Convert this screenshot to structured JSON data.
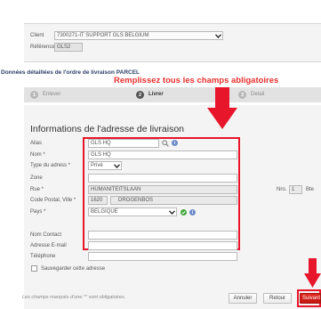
{
  "colors": {
    "accent_red": "#e8162b",
    "title_red": "#e8312f",
    "panel_bg": "#f4f4f4",
    "tab_bar_bg": "#e2e2e2",
    "step_active_bg": "#555555",
    "step_inactive_bg": "#b8b8b8",
    "ok_green": "#3fa93a",
    "info_blue": "#6c8cc8"
  },
  "top_panel": {
    "client_label": "Client",
    "client_value": "7300271-IT SUPPORT GLS BELGIUM",
    "reference_label": "Référence",
    "reference_value": "GLS2"
  },
  "section_title": "Données détaillées de l'ordre de livraison PARCEL",
  "annotation_text": "Remplissez tous les champs abligatoires",
  "steps": [
    {
      "number": "1",
      "label": "Enlever"
    },
    {
      "number": "2",
      "label": "Livrer"
    },
    {
      "number": "3",
      "label": "Detail"
    }
  ],
  "form": {
    "title": "Informations de l'adresse de livraison",
    "alias_label": "Alias",
    "alias_value": "GLS HQ",
    "nom_label": "Nom *",
    "nom_value": "GLS HQ",
    "type_label": "Type du adress *",
    "type_value": "Privé",
    "zone_label": "Zone",
    "zone_value": "",
    "rue_label": "Rue *",
    "rue_value": "HUMANITEITSLAAN",
    "nro_label": "Nro.",
    "nro_value": "1",
    "bte_label": "Bte",
    "bte_value": "",
    "cp_label": "Code Postal, Ville *",
    "cp_value": "1620",
    "ville_value": "DROGENBOS",
    "pays_label": "Pays *",
    "pays_value": "BELGIQUE",
    "contact_label": "Nom Contact",
    "email_label": "Adresse E-mail",
    "tel_label": "Téléphone",
    "save_label": "Sauvegarder cette adresse"
  },
  "footer": {
    "note": "Les champs marqués d'une '*' sont obligatoires.",
    "annuler_label": "Annuler",
    "retour_label": "Retour",
    "suivant_label": "Suivant"
  },
  "icons": {
    "alias_search": "search-icon",
    "alias_info": "info-icon",
    "pays_ok": "check-circle-icon",
    "pays_info": "info-icon",
    "arrow_main": "arrow-down-icon",
    "arrow_corner": "arrow-down-icon"
  }
}
